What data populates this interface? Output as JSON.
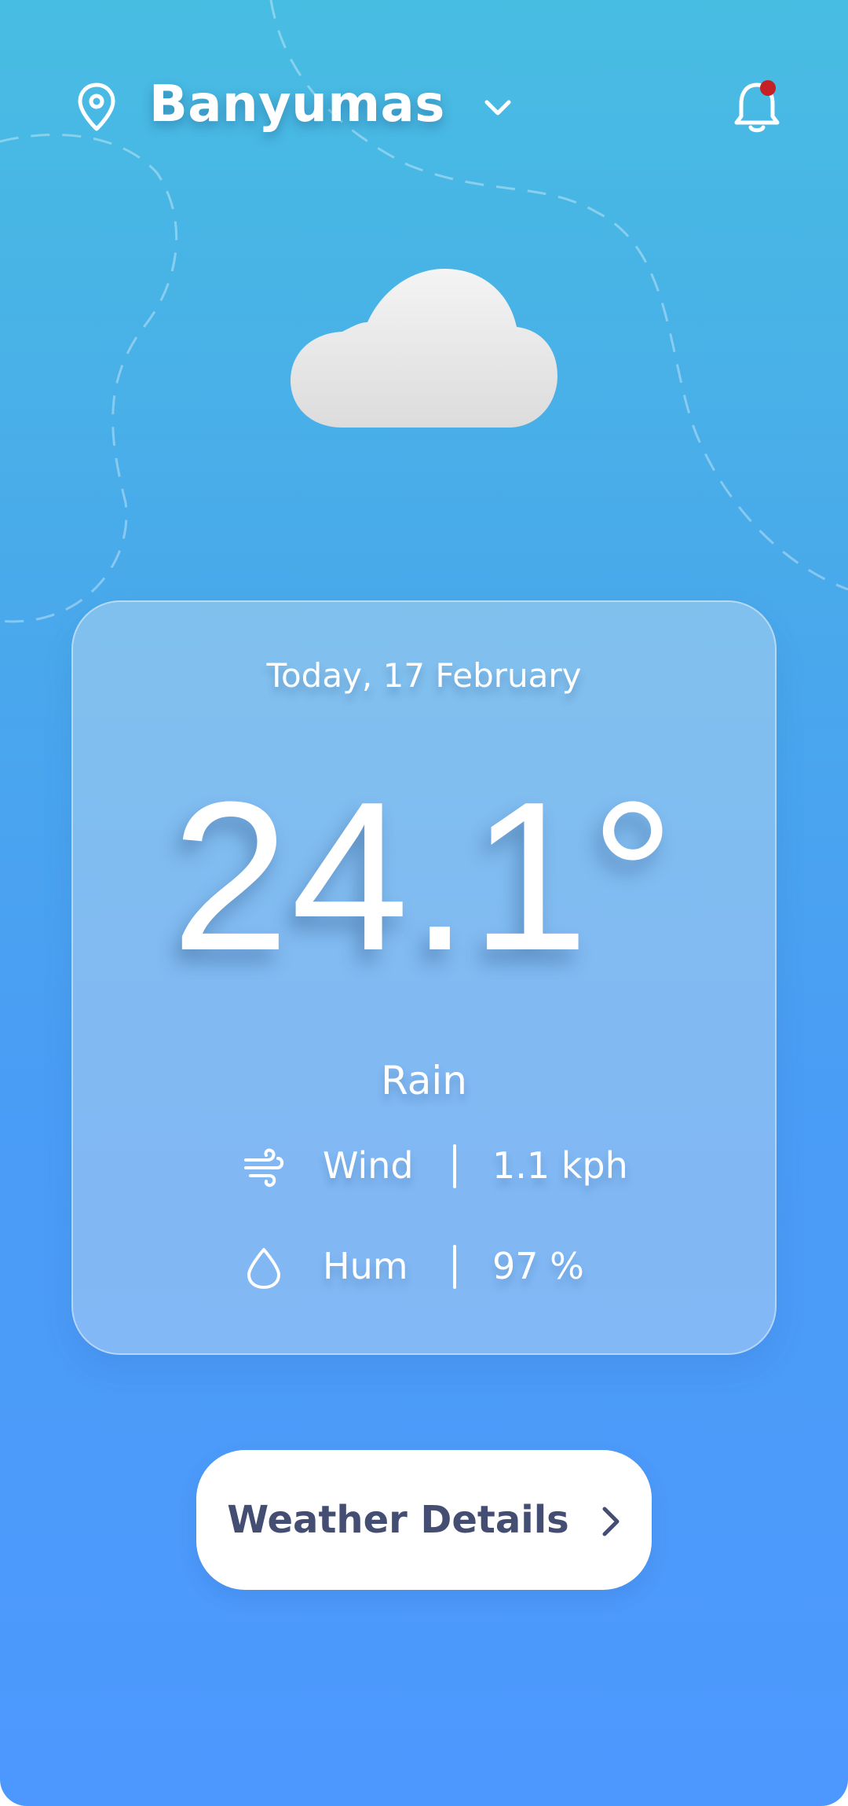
{
  "header": {
    "location": "Banyumas",
    "has_notification": true
  },
  "weather": {
    "date": "Today, 17 February",
    "temperature": "24.1°",
    "condition": "Rain",
    "stats": [
      {
        "label": "Wind",
        "value": "1.1 kph",
        "icon": "wind-icon"
      },
      {
        "label": "Hum",
        "value": "97 %",
        "icon": "droplet-icon"
      }
    ]
  },
  "actions": {
    "details_label": "Weather Details"
  },
  "colors": {
    "background_top": "#48bde2",
    "background_bottom": "#4d98fe",
    "button_text": "#444e72",
    "notification_dot": "#c52026"
  },
  "icons": {
    "location": "map-pin-icon",
    "dropdown": "chevron-down-icon",
    "notifications": "bell-icon",
    "weather": "rain-cloud-icon",
    "details": "chevron-right-icon"
  }
}
